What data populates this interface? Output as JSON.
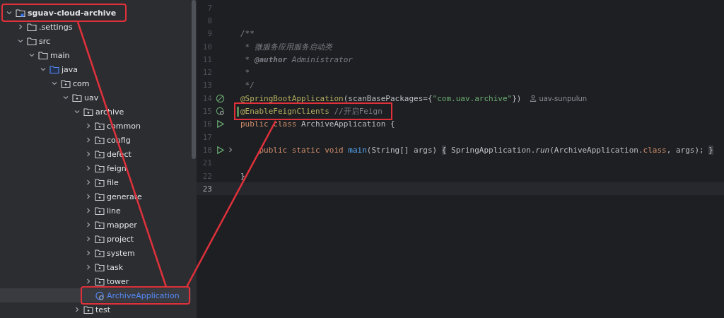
{
  "project_tree": [
    {
      "label": "sguav-cloud-archive",
      "kind": "module",
      "expanded": true,
      "selected": false,
      "callout": true,
      "children": [
        {
          "label": ".settings",
          "kind": "folder",
          "expanded": false,
          "selected": false
        },
        {
          "label": "src",
          "kind": "folder",
          "expanded": true,
          "selected": false,
          "children": [
            {
              "label": "main",
              "kind": "folder",
              "expanded": true,
              "selected": false,
              "children": [
                {
                  "label": "java",
                  "kind": "source",
                  "expanded": true,
                  "selected": false,
                  "children": [
                    {
                      "label": "com",
                      "kind": "package",
                      "expanded": true,
                      "selected": false,
                      "children": [
                        {
                          "label": "uav",
                          "kind": "package",
                          "expanded": true,
                          "selected": false,
                          "children": [
                            {
                              "label": "archive",
                              "kind": "package",
                              "expanded": true,
                              "selected": false,
                              "children": [
                                {
                                  "label": "common",
                                  "kind": "package",
                                  "expanded": false,
                                  "selected": false
                                },
                                {
                                  "label": "config",
                                  "kind": "package",
                                  "expanded": false,
                                  "selected": false
                                },
                                {
                                  "label": "defect",
                                  "kind": "package",
                                  "expanded": false,
                                  "selected": false
                                },
                                {
                                  "label": "feign",
                                  "kind": "package",
                                  "expanded": false,
                                  "selected": false
                                },
                                {
                                  "label": "file",
                                  "kind": "package",
                                  "expanded": false,
                                  "selected": false
                                },
                                {
                                  "label": "generate",
                                  "kind": "package",
                                  "expanded": false,
                                  "selected": false
                                },
                                {
                                  "label": "line",
                                  "kind": "package",
                                  "expanded": false,
                                  "selected": false
                                },
                                {
                                  "label": "mapper",
                                  "kind": "package",
                                  "expanded": false,
                                  "selected": false
                                },
                                {
                                  "label": "project",
                                  "kind": "package",
                                  "expanded": false,
                                  "selected": false
                                },
                                {
                                  "label": "system",
                                  "kind": "package",
                                  "expanded": false,
                                  "selected": false
                                },
                                {
                                  "label": "task",
                                  "kind": "package",
                                  "expanded": false,
                                  "selected": false
                                },
                                {
                                  "label": "tower",
                                  "kind": "package",
                                  "expanded": false,
                                  "selected": false
                                },
                                {
                                  "label": "ArchiveApplication",
                                  "kind": "class",
                                  "selected": true,
                                  "callout": true
                                }
                              ]
                            },
                            {
                              "label": "test",
                              "kind": "package",
                              "expanded": false,
                              "selected": false
                            }
                          ]
                        }
                      ]
                    }
                  ]
                }
              ]
            }
          ]
        }
      ]
    }
  ],
  "editor": {
    "lines": [
      {
        "number": "7"
      },
      {
        "number": "8"
      },
      {
        "number": "9",
        "tokens": [
          {
            "text": "/**",
            "kind": "comment"
          }
        ]
      },
      {
        "number": "10",
        "tokens": [
          {
            "text": " * 微服务应用服务启动类",
            "kind": "comment"
          }
        ]
      },
      {
        "number": "11",
        "tokens": [
          {
            "text": " * ",
            "kind": "comment"
          },
          {
            "text": "@author",
            "kind": "doctag"
          },
          {
            "text": " Administrator",
            "kind": "comment"
          }
        ]
      },
      {
        "number": "12",
        "tokens": [
          {
            "text": " *",
            "kind": "comment"
          }
        ]
      },
      {
        "number": "13",
        "tokens": [
          {
            "text": " */",
            "kind": "comment"
          }
        ]
      },
      {
        "number": "14",
        "marker": {
          "kind": "bean"
        },
        "tokens": [
          {
            "text": "@SpringBootApplication",
            "kind": "annotation"
          },
          {
            "text": "(scanBasePackages={",
            "kind": "plain"
          },
          {
            "text": "\"com.uav.archive\"",
            "kind": "string"
          },
          {
            "text": "})",
            "kind": "plain"
          }
        ],
        "author_hint": "uav-sunpulun"
      },
      {
        "number": "15",
        "marker": {
          "kind": "bean-search"
        },
        "modified": true,
        "callout": true,
        "tokens": [
          {
            "text": "@EnableFeignClients",
            "kind": "annotation"
          },
          {
            "text": " //开启Feign",
            "kind": "linecomment"
          }
        ]
      },
      {
        "number": "16",
        "marker": {
          "kind": "run"
        },
        "tokens": [
          {
            "text": "public class",
            "kind": "keyword"
          },
          {
            "text": " ArchiveApplication {",
            "kind": "plain"
          }
        ]
      },
      {
        "number": "17"
      },
      {
        "number": "18",
        "marker": {
          "kind": "run"
        },
        "folded": true,
        "tokens": [
          {
            "text": "    public static void",
            "kind": "keyword"
          },
          {
            "text": " main",
            "kind": "method"
          },
          {
            "text": "(String[] args) ",
            "kind": "plain"
          },
          {
            "text": "{",
            "kind": "fold"
          },
          {
            "text": " SpringApplication.",
            "kind": "plain"
          },
          {
            "text": "run",
            "kind": "static"
          },
          {
            "text": "(ArchiveApplication.",
            "kind": "plain"
          },
          {
            "text": "class",
            "kind": "keyword"
          },
          {
            "text": ", args); ",
            "kind": "plain"
          },
          {
            "text": "}",
            "kind": "fold"
          }
        ]
      },
      {
        "number": "21"
      },
      {
        "number": "22",
        "tokens": [
          {
            "text": "}",
            "kind": "plain"
          }
        ]
      },
      {
        "number": "23",
        "current": true
      }
    ]
  }
}
